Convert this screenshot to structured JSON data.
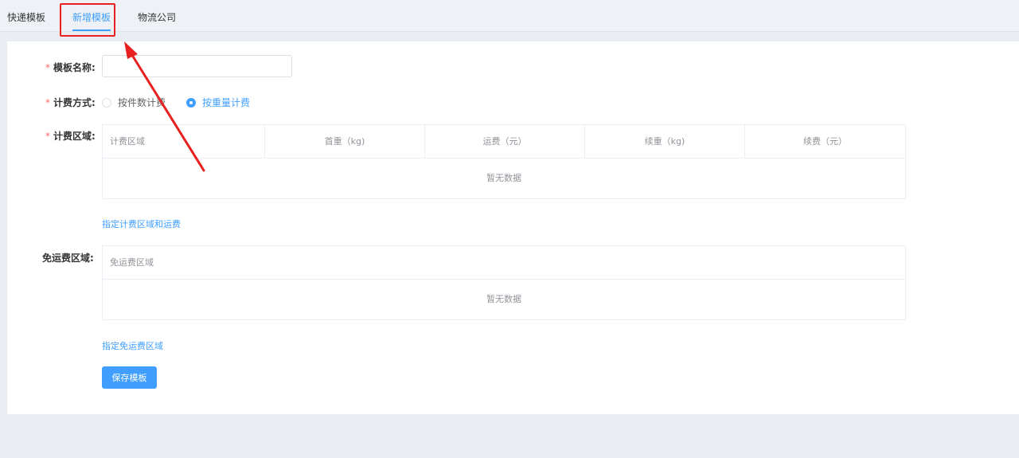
{
  "tabs": [
    {
      "label": "快递模板",
      "active": false
    },
    {
      "label": "新增模板",
      "active": true
    },
    {
      "label": "物流公司",
      "active": false
    }
  ],
  "form": {
    "template_name": {
      "label": "模板名称:",
      "value": "",
      "placeholder": ""
    },
    "billing_method": {
      "label": "计费方式:",
      "options": [
        {
          "label": "按件数计费",
          "checked": false
        },
        {
          "label": "按重量计费",
          "checked": true
        }
      ]
    },
    "billing_region": {
      "label": "计费区域:",
      "columns": [
        "计费区域",
        "首重（kg)",
        "运费（元）",
        "续重（kg)",
        "续费（元）"
      ],
      "rows": [],
      "empty_text": "暂无数据",
      "add_link": "指定计费区域和运费"
    },
    "free_region": {
      "label": "免运费区域:",
      "columns": [
        "免运费区域"
      ],
      "rows": [],
      "empty_text": "暂无数据",
      "add_link": "指定免运费区域"
    },
    "save_button": "保存模板"
  },
  "colors": {
    "primary": "#409eff",
    "required": "#f56c6c",
    "annotation": "#e8201f",
    "background": "#e9edf2"
  }
}
